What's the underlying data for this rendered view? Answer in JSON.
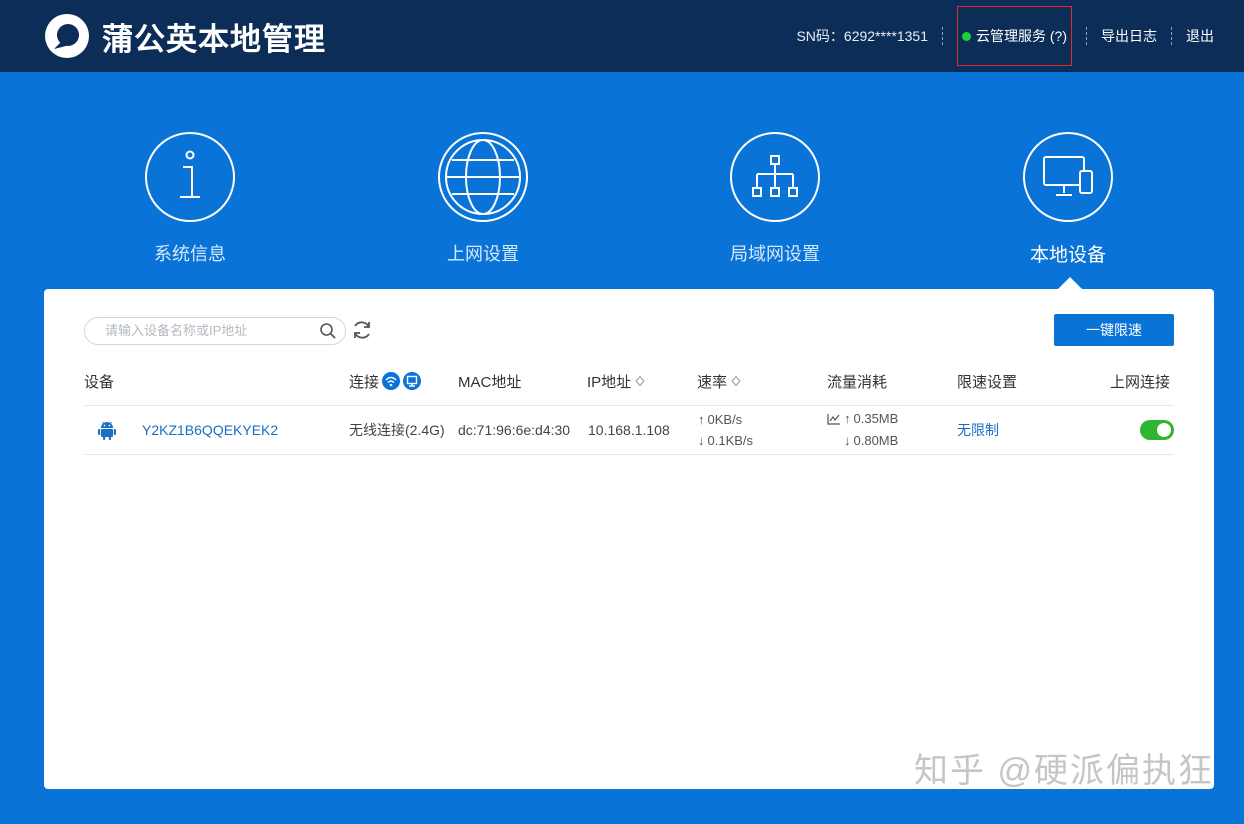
{
  "header": {
    "title": "蒲公英本地管理",
    "sn": "SN码：6292****1351",
    "cloud_service": "云管理服务 (?)",
    "export_log": "导出日志",
    "logout": "退出"
  },
  "nav": {
    "items": [
      {
        "label": "系统信息",
        "icon": "info-icon"
      },
      {
        "label": "上网设置",
        "icon": "globe-icon"
      },
      {
        "label": "局域网设置",
        "icon": "network-icon"
      },
      {
        "label": "本地设备",
        "icon": "devices-icon"
      }
    ],
    "active": "本地设备"
  },
  "toolbar": {
    "search_placeholder": "请输入设备名称或IP地址",
    "limit_button": "一键限速"
  },
  "table": {
    "headers": [
      "设备",
      "连接",
      "MAC地址",
      "IP地址",
      "速率",
      "流量消耗",
      "限速设置",
      "上网连接"
    ],
    "rows": [
      {
        "device": "Y2KZ1B6QQEKYEK2",
        "connection": "无线连接(2.4G)",
        "mac": "dc:71:96:6e:d4:30",
        "ip": "10.168.1.108",
        "rate_up": "0KB/s",
        "rate_down": "0.1KB/s",
        "traffic_up": "0.35MB",
        "traffic_down": "0.80MB",
        "limit": "无限制",
        "online": true
      }
    ]
  },
  "watermark": "知乎 @硬派偏执狂",
  "colors": {
    "header_bg": "#0b2d57",
    "page_bg": "#0a73d8",
    "status_green": "#18d43a",
    "toggle_on": "#2fb52f"
  }
}
